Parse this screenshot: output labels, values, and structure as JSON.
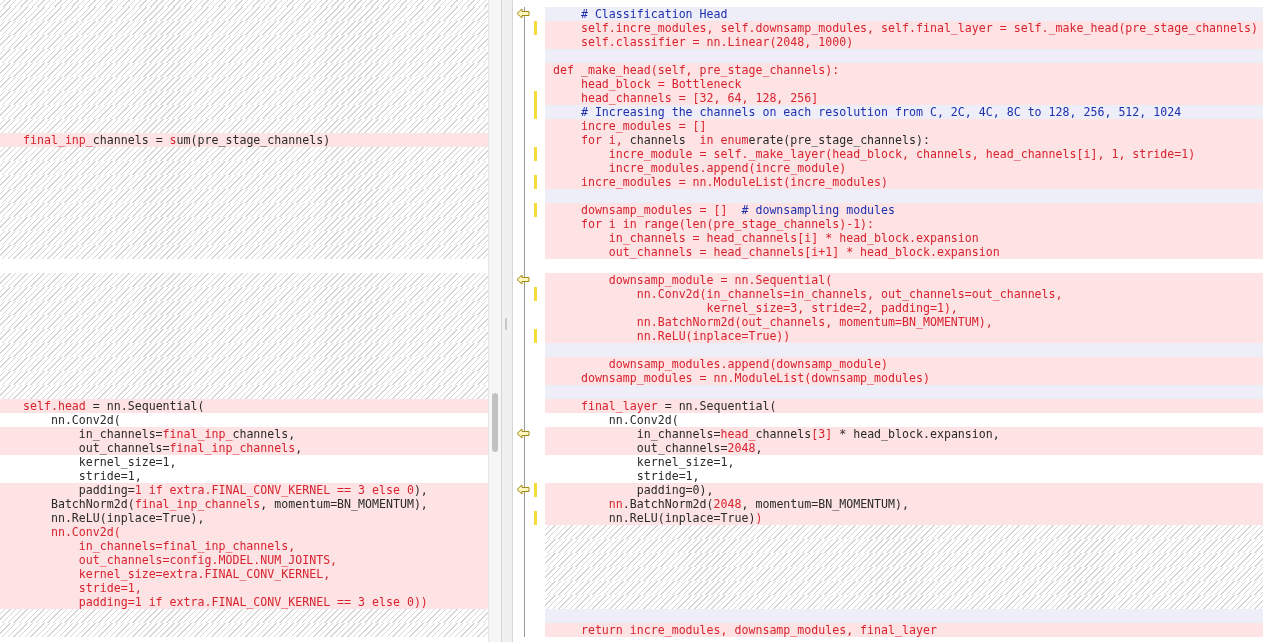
{
  "left_pane": {
    "lines": [
      {
        "kind": "gap"
      },
      {
        "kind": "gap"
      },
      {
        "kind": "gap"
      },
      {
        "kind": "gap"
      },
      {
        "kind": "gap"
      },
      {
        "kind": "gap"
      },
      {
        "kind": "gap"
      },
      {
        "kind": "gap"
      },
      {
        "kind": "gap"
      },
      {
        "kind": "changed",
        "segments": [
          {
            "text": "final_inp_",
            "kind": "changed"
          },
          {
            "text": "channels = ",
            "kind": "plain"
          },
          {
            "text": "s",
            "kind": "changed"
          },
          {
            "text": "um(pre_stage_channels)",
            "kind": "plain"
          }
        ]
      },
      {
        "kind": "gap"
      },
      {
        "kind": "gap"
      },
      {
        "kind": "gap"
      },
      {
        "kind": "gap"
      },
      {
        "kind": "gap"
      },
      {
        "kind": "gap"
      },
      {
        "kind": "gap"
      },
      {
        "kind": "gap"
      },
      {
        "kind": "plain"
      },
      {
        "kind": "gap"
      },
      {
        "kind": "gap"
      },
      {
        "kind": "gap"
      },
      {
        "kind": "gap"
      },
      {
        "kind": "gap"
      },
      {
        "kind": "gap"
      },
      {
        "kind": "gap"
      },
      {
        "kind": "gap"
      },
      {
        "kind": "gap"
      },
      {
        "kind": "changed",
        "segments": [
          {
            "text": "self.head",
            "kind": "changed"
          },
          {
            "text": " = nn.Sequential(",
            "kind": "plain"
          }
        ]
      },
      {
        "kind": "plain",
        "segments": [
          {
            "text": "    nn.Conv2d(",
            "kind": "plain"
          }
        ]
      },
      {
        "kind": "changed",
        "segments": [
          {
            "text": "        in_channels=",
            "kind": "plain"
          },
          {
            "text": "final_inp_",
            "kind": "changed"
          },
          {
            "text": "channels,",
            "kind": "plain"
          }
        ]
      },
      {
        "kind": "changed",
        "segments": [
          {
            "text": "        out_channels=",
            "kind": "plain"
          },
          {
            "text": "final_inp_channels",
            "kind": "changed"
          },
          {
            "text": ",",
            "kind": "plain"
          }
        ]
      },
      {
        "kind": "plain",
        "segments": [
          {
            "text": "        kernel_size=1,",
            "kind": "plain"
          }
        ]
      },
      {
        "kind": "plain",
        "segments": [
          {
            "text": "        stride=1,",
            "kind": "plain"
          }
        ]
      },
      {
        "kind": "changed",
        "segments": [
          {
            "text": "        padding=",
            "kind": "plain"
          },
          {
            "text": "1 if extra.FINAL_CONV_KERNEL == 3 else 0",
            "kind": "changed"
          },
          {
            "text": "),",
            "kind": "plain"
          }
        ]
      },
      {
        "kind": "changed",
        "segments": [
          {
            "text": "    BatchNorm2d(",
            "kind": "plain"
          },
          {
            "text": "final_inp_channels",
            "kind": "changed"
          },
          {
            "text": ", momentum=BN_MOMENTUM),",
            "kind": "plain"
          }
        ]
      },
      {
        "kind": "changed",
        "segments": [
          {
            "text": "    nn.ReLU(inplace=True),",
            "kind": "plain"
          }
        ]
      },
      {
        "kind": "changed",
        "segments": [
          {
            "text": "    nn.Conv2d(",
            "kind": "changed"
          }
        ]
      },
      {
        "kind": "changed",
        "segments": [
          {
            "text": "        in_channels=final_inp_channels,",
            "kind": "changed"
          }
        ]
      },
      {
        "kind": "changed",
        "segments": [
          {
            "text": "        out_channels=config.MODEL.NUM_JOINTS,",
            "kind": "changed"
          }
        ]
      },
      {
        "kind": "changed",
        "segments": [
          {
            "text": "        kernel_size=extra.FINAL_CONV_KERNEL,",
            "kind": "changed"
          }
        ]
      },
      {
        "kind": "changed",
        "segments": [
          {
            "text": "        stride=1,",
            "kind": "changed"
          }
        ]
      },
      {
        "kind": "changed",
        "segments": [
          {
            "text": "        padding=1 if extra.FINAL_CONV_KERNEL == 3 else 0))",
            "kind": "changed"
          }
        ]
      },
      {
        "kind": "gap"
      },
      {
        "kind": "gap"
      }
    ]
  },
  "right_pane": {
    "lines": [
      {
        "kind": "blank",
        "arrow": true,
        "change_bar": false,
        "segments": [
          {
            "text": "    # Classification Head",
            "kind": "comment"
          }
        ]
      },
      {
        "kind": "changed",
        "arrow": false,
        "change_bar": true,
        "segments": [
          {
            "text": "    self.incre_modules, self.downsamp_modules, self.final_layer = self._make_head(pre_stage_channels)",
            "kind": "changed"
          }
        ]
      },
      {
        "kind": "changed",
        "arrow": false,
        "change_bar": false,
        "segments": [
          {
            "text": "    self.classifier = nn.Linear(2048, 1000)",
            "kind": "changed"
          }
        ]
      },
      {
        "kind": "blank",
        "arrow": false,
        "change_bar": false
      },
      {
        "kind": "changed",
        "arrow": false,
        "change_bar": false,
        "segments": [
          {
            "text": "def _make_head(self, pre_stage_channels):",
            "kind": "changed"
          }
        ]
      },
      {
        "kind": "changed",
        "arrow": false,
        "change_bar": false,
        "segments": [
          {
            "text": "    head_block = Bottleneck",
            "kind": "changed"
          }
        ]
      },
      {
        "kind": "changed",
        "arrow": false,
        "change_bar": true,
        "segments": [
          {
            "text": "    head_channels = [32, 64, 128, 256]",
            "kind": "changed"
          }
        ]
      },
      {
        "kind": "blank",
        "arrow": false,
        "change_bar": true,
        "segments": [
          {
            "text": "    # Increasing the channels on each resolution from C, 2C, 4C, 8C to 128, 256, 512, 1024",
            "kind": "comment"
          }
        ]
      },
      {
        "kind": "changed",
        "arrow": false,
        "change_bar": false,
        "segments": [
          {
            "text": "    incre_modules = []",
            "kind": "changed"
          }
        ]
      },
      {
        "kind": "changed",
        "arrow": false,
        "change_bar": false,
        "segments": [
          {
            "text": "    for i, ",
            "kind": "changed"
          },
          {
            "text": "channels",
            "kind": "plain"
          },
          {
            "text": "  in enum",
            "kind": "changed"
          },
          {
            "text": "erate(pre_stage_channels):",
            "kind": "plain"
          }
        ]
      },
      {
        "kind": "changed",
        "arrow": false,
        "change_bar": true,
        "segments": [
          {
            "text": "        incre_module = self._make_layer(head_block, channels, head_channels[i], 1, stride=1)",
            "kind": "changed"
          }
        ]
      },
      {
        "kind": "changed",
        "arrow": false,
        "change_bar": false,
        "segments": [
          {
            "text": "        incre_modules.append(incre_module)",
            "kind": "changed"
          }
        ]
      },
      {
        "kind": "changed",
        "arrow": false,
        "change_bar": true,
        "segments": [
          {
            "text": "    incre_modules = nn.ModuleList(incre_modules)",
            "kind": "changed"
          }
        ]
      },
      {
        "kind": "blank",
        "arrow": false,
        "change_bar": false
      },
      {
        "kind": "changed",
        "arrow": false,
        "change_bar": true,
        "segments": [
          {
            "text": "    downsamp_modules = []  ",
            "kind": "changed"
          },
          {
            "text": "# downsampling modules",
            "kind": "comment"
          }
        ]
      },
      {
        "kind": "changed",
        "arrow": false,
        "change_bar": false,
        "segments": [
          {
            "text": "    for i in range(len(pre_stage_channels)-1):",
            "kind": "changed"
          }
        ]
      },
      {
        "kind": "changed",
        "arrow": false,
        "change_bar": false,
        "segments": [
          {
            "text": "        in_channels = head_channels[i] * head_block.expansion",
            "kind": "changed"
          }
        ]
      },
      {
        "kind": "changed",
        "arrow": false,
        "change_bar": false,
        "segments": [
          {
            "text": "        out_channels = head_channels[i+1] * head_block.expansion",
            "kind": "changed"
          }
        ]
      },
      {
        "kind": "plain",
        "arrow": false,
        "change_bar": false
      },
      {
        "kind": "changed",
        "arrow": true,
        "change_bar": false,
        "segments": [
          {
            "text": "        downsamp_module = nn.Sequential(",
            "kind": "changed"
          }
        ]
      },
      {
        "kind": "changed",
        "arrow": false,
        "change_bar": true,
        "segments": [
          {
            "text": "            nn.Conv2d(in_channels=in_channels, out_channels=out_channels,",
            "kind": "changed"
          }
        ]
      },
      {
        "kind": "changed",
        "arrow": false,
        "change_bar": false,
        "segments": [
          {
            "text": "                      kernel_size=3, stride=2, padding=1),",
            "kind": "changed"
          }
        ]
      },
      {
        "kind": "changed",
        "arrow": false,
        "change_bar": false,
        "segments": [
          {
            "text": "            nn.BatchNorm2d(out_channels, momentum=BN_MOMENTUM),",
            "kind": "changed"
          }
        ]
      },
      {
        "kind": "changed",
        "arrow": false,
        "change_bar": true,
        "segments": [
          {
            "text": "            nn.ReLU(inplace=True))",
            "kind": "changed"
          }
        ]
      },
      {
        "kind": "blank",
        "arrow": false,
        "change_bar": false
      },
      {
        "kind": "changed",
        "arrow": false,
        "change_bar": false,
        "segments": [
          {
            "text": "        downsamp_modules.append(downsamp_module)",
            "kind": "changed"
          }
        ]
      },
      {
        "kind": "changed",
        "arrow": false,
        "change_bar": false,
        "segments": [
          {
            "text": "    downsamp_modules = nn.ModuleList(downsamp_modules)",
            "kind": "changed"
          }
        ]
      },
      {
        "kind": "blank",
        "arrow": false,
        "change_bar": false
      },
      {
        "kind": "changed",
        "arrow": false,
        "change_bar": false,
        "segments": [
          {
            "text": "    final_layer",
            "kind": "changed"
          },
          {
            "text": " = nn.Sequential(",
            "kind": "plain"
          }
        ]
      },
      {
        "kind": "plain",
        "arrow": false,
        "change_bar": false,
        "segments": [
          {
            "text": "        nn.Conv2d(",
            "kind": "plain"
          }
        ]
      },
      {
        "kind": "changed",
        "arrow": true,
        "change_bar": false,
        "segments": [
          {
            "text": "            in_channels=",
            "kind": "plain"
          },
          {
            "text": "head_",
            "kind": "changed"
          },
          {
            "text": "channels",
            "kind": "plain"
          },
          {
            "text": "[3]",
            "kind": "changed"
          },
          {
            "text": " * head_block.expansion,",
            "kind": "plain"
          }
        ]
      },
      {
        "kind": "changed",
        "arrow": false,
        "change_bar": false,
        "segments": [
          {
            "text": "            out_channels=",
            "kind": "plain"
          },
          {
            "text": "2048",
            "kind": "changed"
          },
          {
            "text": ",",
            "kind": "plain"
          }
        ]
      },
      {
        "kind": "plain",
        "arrow": false,
        "change_bar": false,
        "segments": [
          {
            "text": "            kernel_size=1,",
            "kind": "plain"
          }
        ]
      },
      {
        "kind": "plain",
        "arrow": false,
        "change_bar": false,
        "segments": [
          {
            "text": "            stride=1,",
            "kind": "plain"
          }
        ]
      },
      {
        "kind": "changed",
        "arrow": true,
        "change_bar": true,
        "segments": [
          {
            "text": "            padding=0),",
            "kind": "plain"
          }
        ]
      },
      {
        "kind": "changed",
        "arrow": false,
        "change_bar": false,
        "segments": [
          {
            "text": "        nn",
            "kind": "changed"
          },
          {
            "text": ".BatchNorm2d(",
            "kind": "plain"
          },
          {
            "text": "2048",
            "kind": "changed"
          },
          {
            "text": ", momentum=BN_MOMENTUM),",
            "kind": "plain"
          }
        ]
      },
      {
        "kind": "changed",
        "arrow": false,
        "change_bar": true,
        "segments": [
          {
            "text": "        nn.ReLU(inplace=True)",
            "kind": "plain"
          },
          {
            "text": ")",
            "kind": "changed"
          }
        ]
      },
      {
        "kind": "gap",
        "arrow": false,
        "change_bar": false
      },
      {
        "kind": "gap",
        "arrow": false,
        "change_bar": false
      },
      {
        "kind": "gap",
        "arrow": false,
        "change_bar": false
      },
      {
        "kind": "gap",
        "arrow": false,
        "change_bar": false
      },
      {
        "kind": "gap",
        "arrow": false,
        "change_bar": false
      },
      {
        "kind": "gap",
        "arrow": false,
        "change_bar": false
      },
      {
        "kind": "blank",
        "arrow": false,
        "change_bar": false
      },
      {
        "kind": "changed",
        "arrow": false,
        "change_bar": false,
        "segments": [
          {
            "text": "    return incre_modules, downsamp_modules, final_layer",
            "kind": "changed"
          }
        ]
      }
    ]
  }
}
